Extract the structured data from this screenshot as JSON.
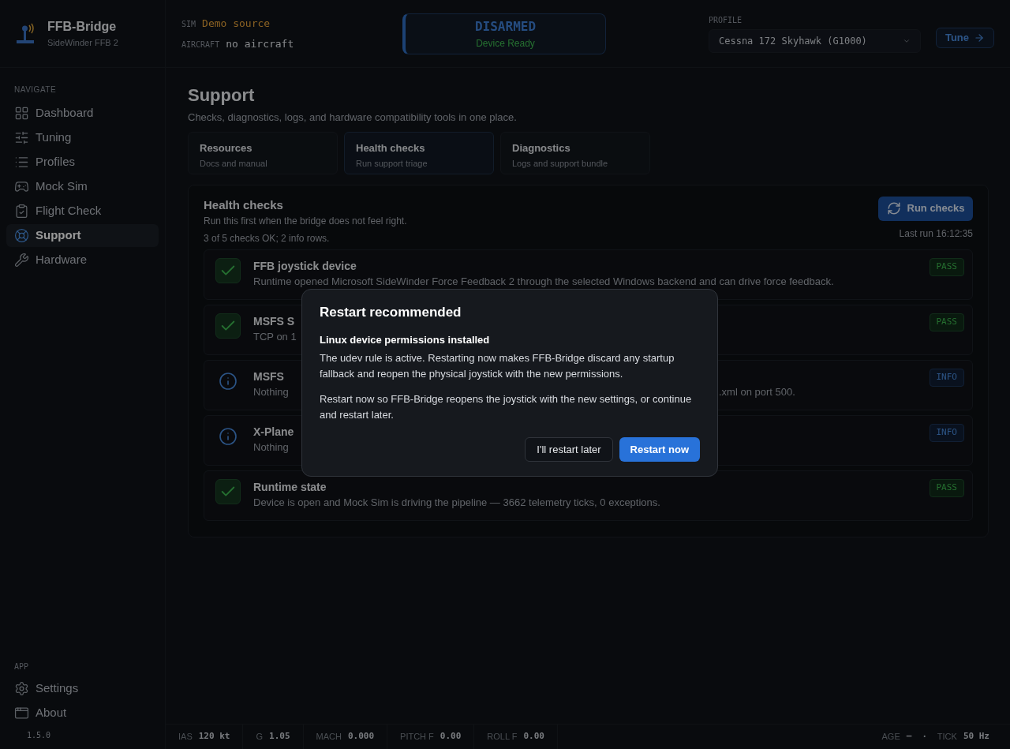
{
  "app": {
    "name": "FFB-Bridge",
    "subtitle": "SideWinder FFB 2"
  },
  "sim": {
    "label": "SIM",
    "value": "Demo source"
  },
  "aircraft": {
    "label": "AIRCRAFT",
    "value": "no aircraft"
  },
  "status": {
    "state": "DISARMED",
    "detail": "Device Ready"
  },
  "profile": {
    "label": "PROFILE",
    "value": "Cessna 172 Skyhawk (G1000)",
    "tune_button": "Tune"
  },
  "nav": {
    "heading": "NAVIGATE",
    "items": [
      {
        "label": "Dashboard",
        "selected": false
      },
      {
        "label": "Tuning",
        "selected": false
      },
      {
        "label": "Profiles",
        "selected": false
      },
      {
        "label": "Mock Sim",
        "selected": false
      },
      {
        "label": "Flight Check",
        "selected": false
      },
      {
        "label": "Support",
        "selected": true
      },
      {
        "label": "Hardware",
        "selected": false
      }
    ]
  },
  "app_section": {
    "heading": "APP",
    "items": [
      {
        "label": "Settings",
        "selected": false
      },
      {
        "label": "About",
        "selected": false
      }
    ],
    "version": "1.5.0"
  },
  "page": {
    "title": "Support",
    "subtitle": "Checks, diagnostics, logs, and hardware compatibility tools in one place.",
    "cards": [
      {
        "title": "Resources",
        "subtitle": "Docs and manual",
        "selected": false
      },
      {
        "title": "Health checks",
        "subtitle": "Run support triage",
        "selected": true
      },
      {
        "title": "Diagnostics",
        "subtitle": "Logs and support bundle",
        "selected": false
      }
    ]
  },
  "health": {
    "title": "Health checks",
    "subtitle": "Run this first when the bridge does not feel right.",
    "summary": "3 of 5 checks OK; 2 info rows.",
    "run_button": "Run checks",
    "last_run": "Last run 16:12:35",
    "checks": [
      {
        "kind": "pass",
        "title": "FFB joystick device",
        "description": [
          "Runtime opened Microsoft SideWinder Force Feedback 2 through the selected Windows backend and can drive force feedback."
        ],
        "badge": "PASS"
      },
      {
        "kind": "pass",
        "title": "MSFS S",
        "description": [
          "TCP on 1"
        ],
        "badge": "PASS"
      },
      {
        "kind": "info",
        "title": "MSFS",
        "description": [
          "Nothing",
          ".xml on port 500."
        ],
        "badge": "INFO"
      },
      {
        "kind": "info",
        "title": "X-Plane",
        "description": [
          "Nothing"
        ],
        "badge": "INFO"
      },
      {
        "kind": "pass",
        "title": "Runtime state",
        "description": [
          "Device is open and Mock Sim is driving the pipeline — 3662 telemetry ticks, 0 exceptions."
        ],
        "badge": "PASS"
      }
    ]
  },
  "modal": {
    "title": "Restart recommended",
    "subtitle": "Linux device permissions installed",
    "paragraphs": [
      "The udev rule is active. Restarting now makes FFB-Bridge discard any startup fallback and reopen the physical joystick with the new permissions.",
      "Restart now so FFB-Bridge reopens the joystick with the new settings, or continue and restart later."
    ],
    "buttons": [
      {
        "label": "I'll restart later",
        "kind": "secondary"
      },
      {
        "label": "Restart now",
        "kind": "primary"
      }
    ]
  },
  "status_bar": {
    "left": [
      {
        "label": "IAS",
        "value": "120 kt"
      },
      {
        "label": "G",
        "value": "1.05"
      },
      {
        "label": "MACH",
        "value": "0.000"
      },
      {
        "label": "PITCH F",
        "value": "0.00"
      },
      {
        "label": "ROLL F",
        "value": "0.00"
      }
    ],
    "right": [
      {
        "label": "AGE",
        "value": "—"
      },
      {
        "label": "TICK",
        "value": "50 Hz"
      }
    ],
    "separator": "·"
  }
}
